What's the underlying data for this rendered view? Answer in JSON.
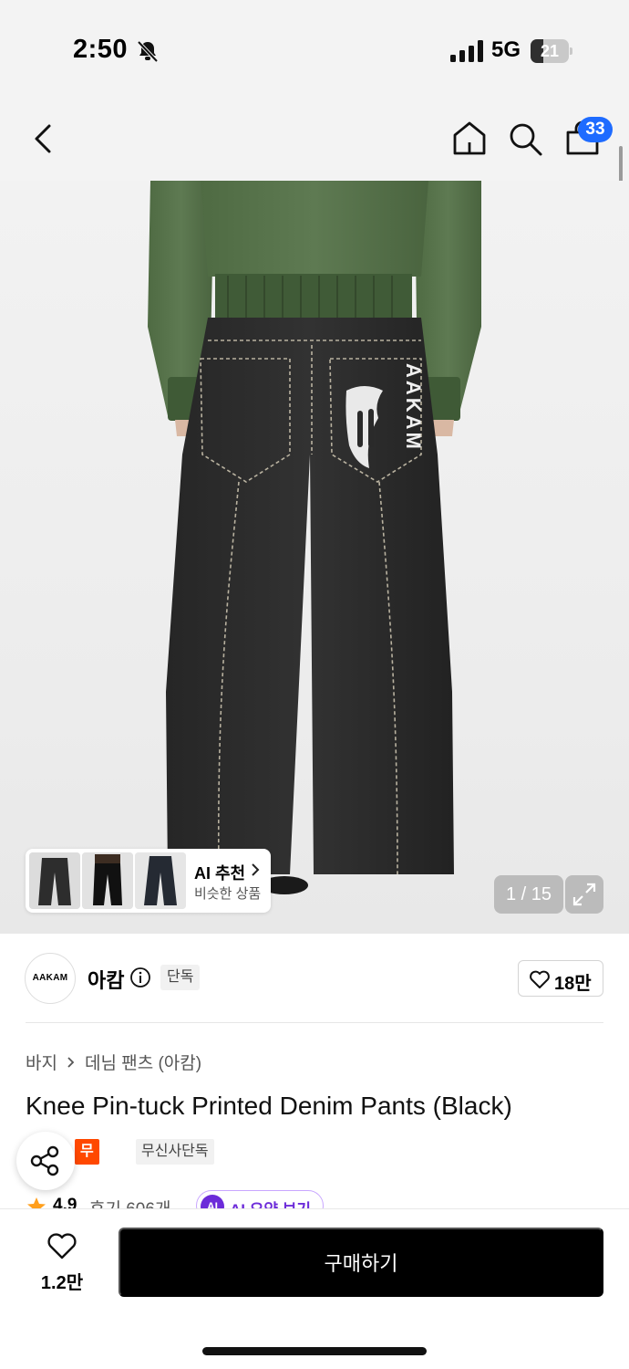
{
  "status_bar": {
    "time": "2:50",
    "network": "5G",
    "battery": "21"
  },
  "header": {
    "cart_count": "33"
  },
  "gallery": {
    "ai_recommend_title": "AI 추천",
    "ai_recommend_subtitle": "비슷한 상품",
    "page_counter": "1 / 15",
    "print_text": "AAKAM"
  },
  "brand": {
    "logo_text": "AAKAM",
    "name": "아캄",
    "badge": "단독",
    "like_count": "18만"
  },
  "product": {
    "breadcrumb": [
      "바지",
      "데님 팬츠 (아캄)"
    ],
    "title": "Knee Pin-tuck Printed Denim Pants (Black)",
    "tags": [
      "무진장",
      "무신사단독"
    ],
    "rating": "4.9",
    "review_label": "후기 606개",
    "ai_summary_icon": "AI",
    "ai_summary_label": "AI 요약 보기"
  },
  "bottom_bar": {
    "wish_count": "1.2만",
    "buy_label": "구매하기"
  },
  "colors": {
    "accent_blue": "#1e6bff",
    "tag_orange": "#ff4800",
    "ai_purple": "#6c2bd9",
    "buy_button": "#000000"
  }
}
